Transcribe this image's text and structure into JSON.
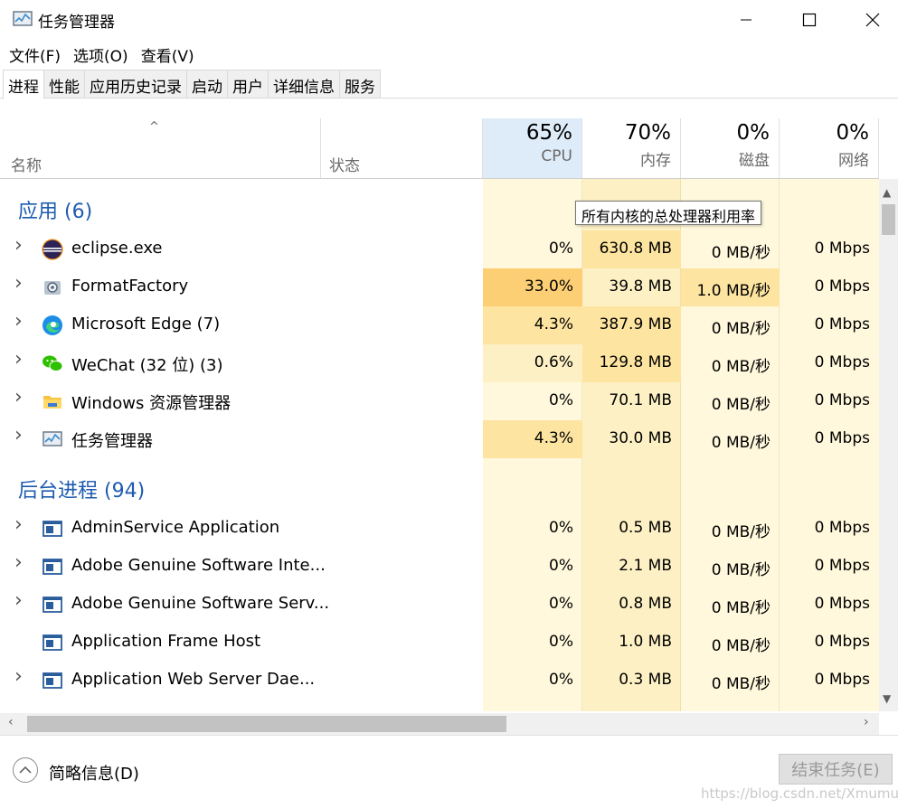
{
  "window": {
    "title": "任务管理器",
    "icon": "task-manager-icon",
    "controls": [
      "minimize-icon",
      "maximize-icon",
      "close-icon"
    ]
  },
  "menubar": [
    {
      "label": "文件(F)"
    },
    {
      "label": "选项(O)"
    },
    {
      "label": "查看(V)"
    }
  ],
  "tabs": [
    {
      "label": "进程",
      "active": true
    },
    {
      "label": "性能"
    },
    {
      "label": "应用历史记录"
    },
    {
      "label": "启动"
    },
    {
      "label": "用户"
    },
    {
      "label": "详细信息"
    },
    {
      "label": "服务"
    }
  ],
  "columns": {
    "sort_glyph": "^",
    "name": "名称",
    "status": "状态",
    "cpu": {
      "pct": "65%",
      "label": "CPU"
    },
    "memory": {
      "pct": "70%",
      "label": "内存"
    },
    "disk": {
      "pct": "0%",
      "label": "磁盘"
    },
    "network": {
      "pct": "0%",
      "label": "网络"
    }
  },
  "tooltip": "所有内核的总处理器利用率",
  "groups": {
    "apps": "应用 (6)",
    "background": "后台进程 (94)"
  },
  "apps": [
    {
      "name": "eclipse.exe",
      "icon": "eclipse-icon",
      "cpu": "0%",
      "mem": "630.8 MB",
      "disk": "0 MB/秒",
      "net": "0 Mbps",
      "expandable": true
    },
    {
      "name": "FormatFactory",
      "icon": "format-factory-icon",
      "cpu": "33.0%",
      "mem": "39.8 MB",
      "disk": "1.0 MB/秒",
      "net": "0 Mbps",
      "expandable": true
    },
    {
      "name": "Microsoft Edge (7)",
      "icon": "edge-icon",
      "cpu": "4.3%",
      "mem": "387.9 MB",
      "disk": "0 MB/秒",
      "net": "0 Mbps",
      "expandable": true
    },
    {
      "name": "WeChat (32 位) (3)",
      "icon": "wechat-icon",
      "cpu": "0.6%",
      "mem": "129.8 MB",
      "disk": "0 MB/秒",
      "net": "0 Mbps",
      "expandable": true
    },
    {
      "name": "Windows 资源管理器",
      "icon": "file-explorer-icon",
      "cpu": "0%",
      "mem": "70.1 MB",
      "disk": "0 MB/秒",
      "net": "0 Mbps",
      "expandable": true
    },
    {
      "name": "任务管理器",
      "icon": "task-manager-icon",
      "cpu": "4.3%",
      "mem": "30.0 MB",
      "disk": "0 MB/秒",
      "net": "0 Mbps",
      "expandable": true
    }
  ],
  "background": [
    {
      "name": "AdminService Application",
      "icon": "app-window-icon",
      "cpu": "0%",
      "mem": "0.5 MB",
      "disk": "0 MB/秒",
      "net": "0 Mbps",
      "expandable": true
    },
    {
      "name": "Adobe Genuine Software Inte...",
      "icon": "app-window-icon",
      "cpu": "0%",
      "mem": "2.1 MB",
      "disk": "0 MB/秒",
      "net": "0 Mbps",
      "expandable": true
    },
    {
      "name": "Adobe Genuine Software Serv...",
      "icon": "app-window-icon",
      "cpu": "0%",
      "mem": "0.8 MB",
      "disk": "0 MB/秒",
      "net": "0 Mbps",
      "expandable": true
    },
    {
      "name": "Application Frame Host",
      "icon": "app-window-icon",
      "cpu": "0%",
      "mem": "1.0 MB",
      "disk": "0 MB/秒",
      "net": "0 Mbps",
      "expandable": false
    },
    {
      "name": "Application Web Server Dae...",
      "icon": "app-window-icon",
      "cpu": "0%",
      "mem": "0.3 MB",
      "disk": "0 MB/秒",
      "net": "0 Mbps",
      "expandable": true
    }
  ],
  "heat_colors": {
    "low": "#fff8dc",
    "mid": "#fdf0c4",
    "high": "#fde4a0",
    "max": "#fccf74",
    "cpu_header": "#deebf8",
    "group_text": "#1e5bb0"
  },
  "footer": {
    "fewer_details": "简略信息(D)",
    "end_task": "结束任务(E)",
    "watermark": "https://blog.csdn.net/Xmumu_"
  }
}
